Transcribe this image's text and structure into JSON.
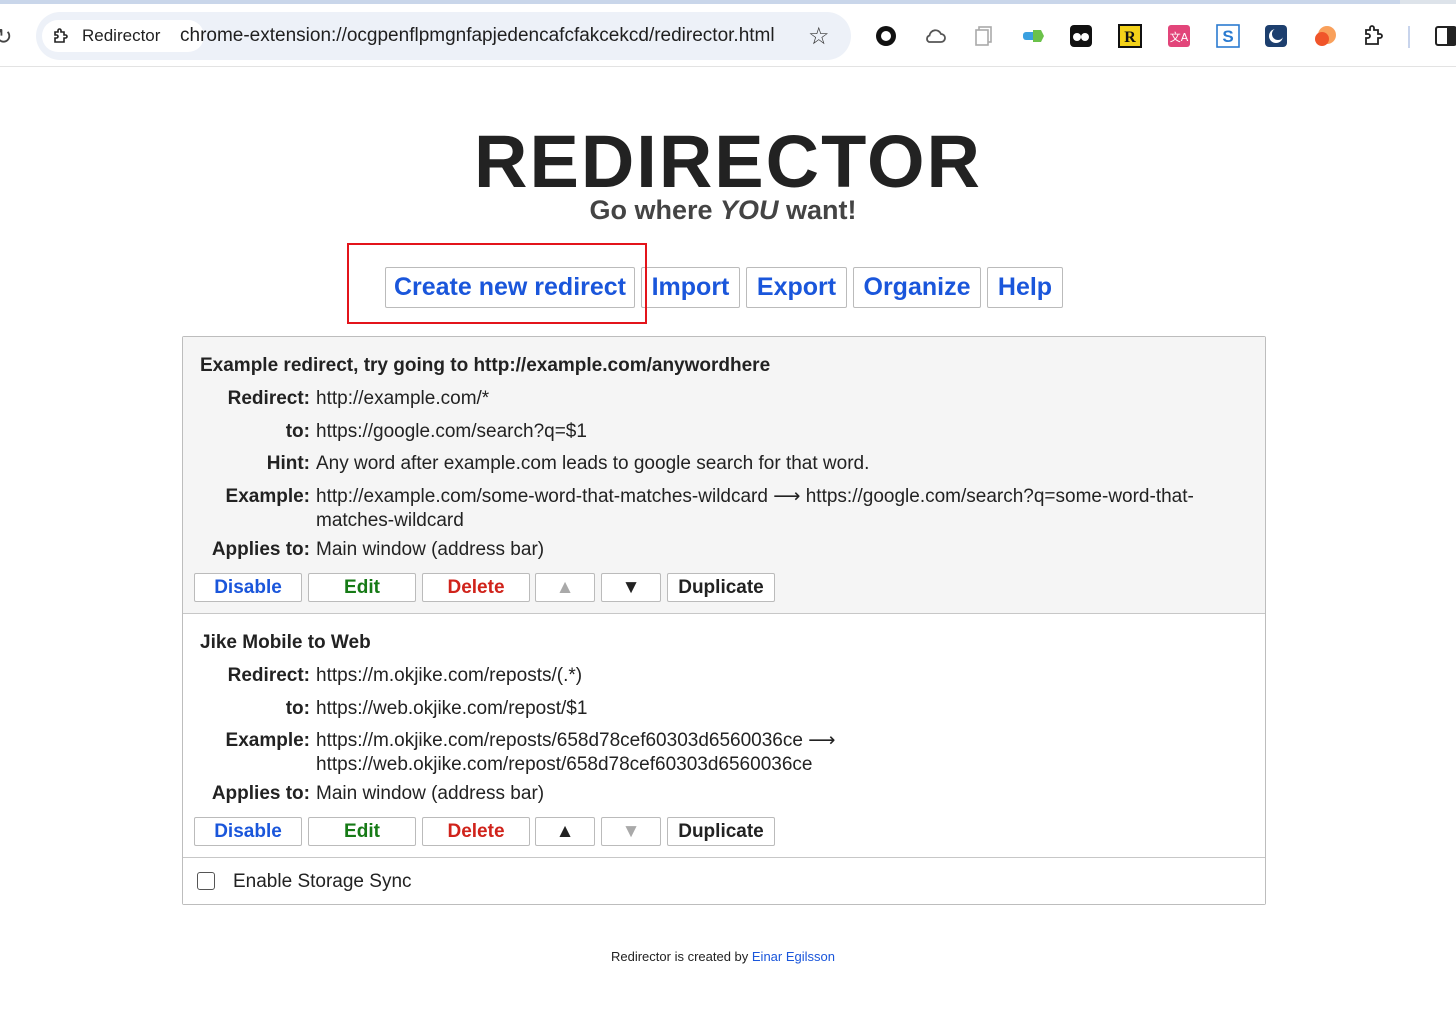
{
  "browser": {
    "tab_chip_label": "Redirector",
    "url": "chrome-extension://ocgpenflpmgnfapjedencafcfakcekcd/redirector.html",
    "extension_icons": [
      "circle-ext-icon",
      "cloud-ext-icon",
      "copy-ext-icon",
      "car-ext-icon",
      "ghost-ext-icon",
      "r-ext-icon",
      "translate-ext-icon",
      "s-ext-icon",
      "moon-ext-icon",
      "orange-ext-icon",
      "puzzle-icon"
    ]
  },
  "page": {
    "logo": "REDIRECTOR",
    "tagline_before": "Go where ",
    "tagline_em": "YOU",
    "tagline_after": " want!"
  },
  "menu": {
    "create": "Create new redirect",
    "import": "Import",
    "export": "Export",
    "organize": "Organize",
    "help": "Help"
  },
  "labels": {
    "redirect": "Redirect:",
    "to": "to:",
    "hint": "Hint:",
    "example": "Example:",
    "applies": "Applies to:"
  },
  "actions": {
    "disable": "Disable",
    "edit": "Edit",
    "delete": "Delete",
    "up": "▲",
    "down": "▼",
    "duplicate": "Duplicate"
  },
  "redirects": [
    {
      "title": "Example redirect, try going to http://example.com/anywordhere",
      "redirect": "http://example.com/*",
      "to": "https://google.com/search?q=$1",
      "hint": "Any word after example.com leads to google search for that word.",
      "example_line1": "http://example.com/some-word-that-matches-wildcard ⟶ https://google.com/search?q=some-word-that-",
      "example_line2": "matches-wildcard",
      "applies": "Main window (address bar)"
    },
    {
      "title": "Jike Mobile to Web",
      "redirect": "https://m.okjike.com/reposts/(.*)",
      "to": "https://web.okjike.com/repost/$1",
      "example_line1": "https://m.okjike.com/reposts/658d78cef60303d6560036ce ⟶",
      "example_line2": "https://web.okjike.com/repost/658d78cef60303d6560036ce",
      "applies": "Main window (address bar)"
    }
  ],
  "sync": {
    "label": "Enable Storage Sync",
    "checked": false
  },
  "footer": {
    "text": "Redirector is created by ",
    "author": "Einar Egilsson"
  },
  "colors": {
    "link_blue": "#1a56db",
    "edit_green": "#167a16",
    "delete_red": "#d0231b",
    "highlight_red": "#e3141b"
  }
}
